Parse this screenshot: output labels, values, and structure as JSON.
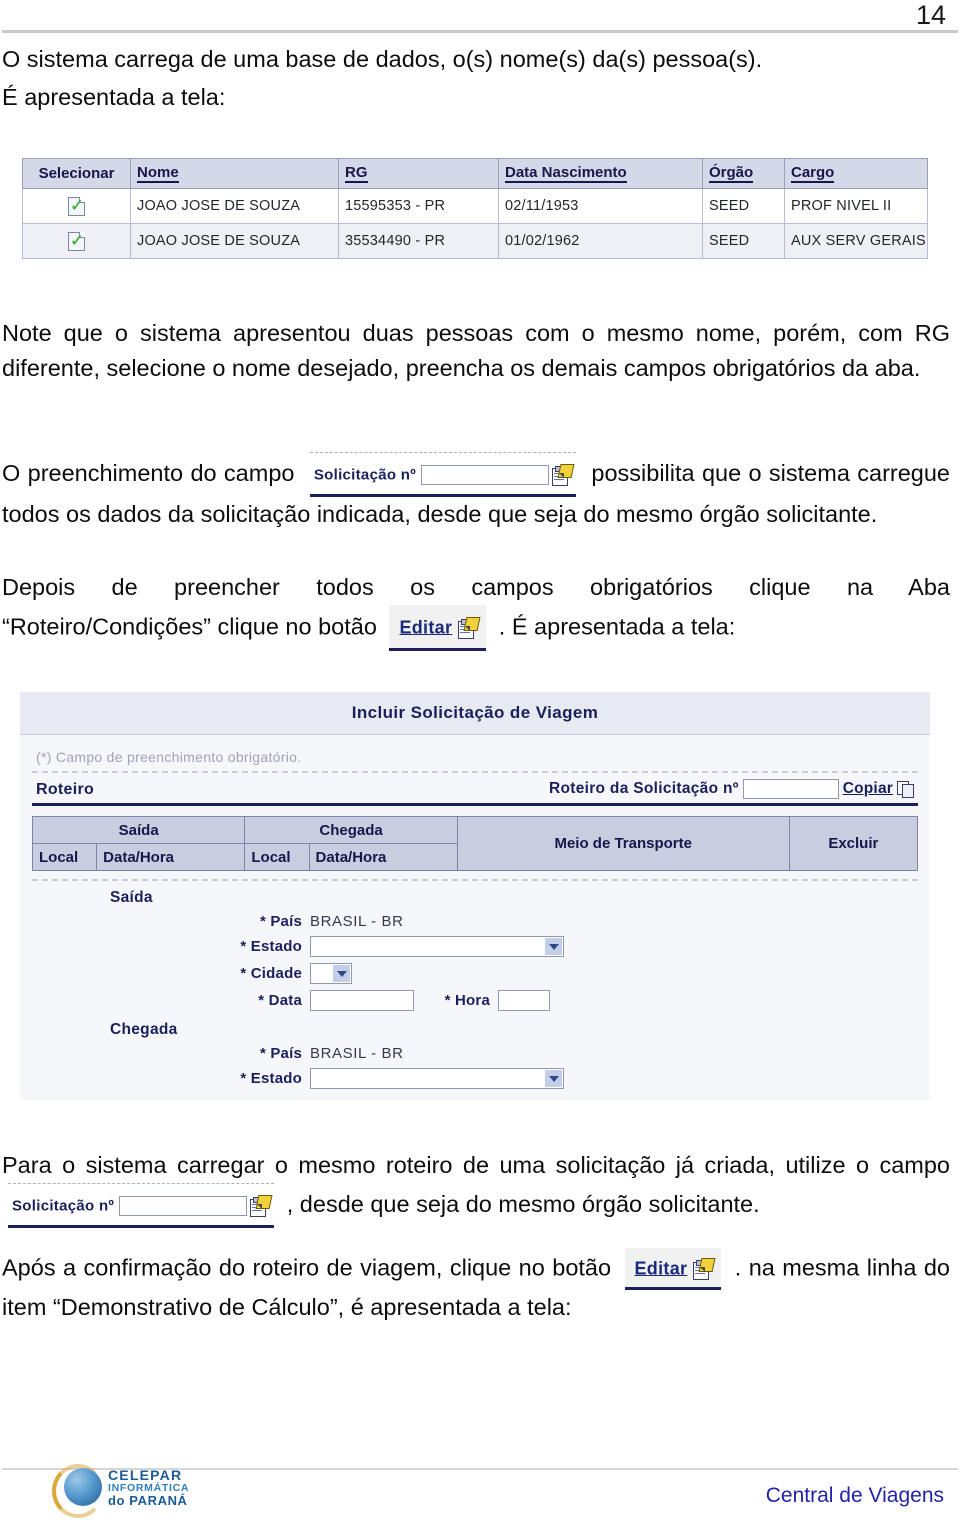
{
  "page": {
    "number": "14",
    "footer_right": "Central de Viagens"
  },
  "intro": {
    "line1": "O sistema carrega de uma base de dados, o(s) nome(s) da(s) pessoa(s).",
    "line2": "É apresentada a tela:"
  },
  "result_table": {
    "headers": [
      "Selecionar",
      "Nome",
      "RG",
      "Data Nascimento",
      "Órgão",
      "Cargo"
    ],
    "rows": [
      {
        "select_icon": "document-check-icon",
        "nome": "JOAO JOSE DE SOUZA",
        "rg": "15595353 - PR",
        "data_nascimento": "02/11/1953",
        "orgao": "SEED",
        "cargo": "PROF NIVEL II"
      },
      {
        "select_icon": "document-check-icon",
        "nome": "JOAO JOSE DE SOUZA",
        "rg": "35534490 - PR",
        "data_nascimento": "01/02/1962",
        "orgao": "SEED",
        "cargo": "AUX SERV GERAIS"
      }
    ]
  },
  "note_paragraph": "Note que o sistema apresentou duas pessoas com o mesmo nome, porém, com RG diferente, selecione o nome desejado, preencha os demais campos obrigatórios da aba.",
  "solicitacao_paragraph": {
    "before": "O preenchimento do campo",
    "widget_label": "Solicitação nº",
    "widget_value": "",
    "after": "possibilita que o sistema carregue todos os dados da solicitação indicada, desde que seja do mesmo órgão solicitante."
  },
  "editar_paragraph": {
    "line1": "Depois de preencher todos os campos obrigatórios clique na Aba",
    "line2_before": "“Roteiro/Condições” clique no botão",
    "button_label": "Editar",
    "line2_after": ". É apresentada a tela:"
  },
  "screenshot": {
    "title": "Incluir Solicitação de Viagem",
    "obligatory_note": "(*) Campo de preenchimento obrigatório.",
    "roteiro_label": "Roteiro",
    "roteiro_solicitacao_label": "Roteiro da Solicitação nº",
    "roteiro_solicitacao_value": "",
    "copiar_label": "Copiar",
    "route_headers": {
      "saida": "Saída",
      "chegada": "Chegada",
      "meio_transporte": "Meio de Transporte",
      "excluir": "Excluir",
      "local": "Local",
      "data_hora": "Data/Hora"
    },
    "saida": {
      "title": "Saída",
      "pais_label": "* País",
      "pais_value": "BRASIL - BR",
      "estado_label": "* Estado",
      "estado_value": "",
      "cidade_label": "* Cidade",
      "cidade_value": "",
      "data_label": "* Data",
      "data_value": "",
      "hora_label": "* Hora",
      "hora_value": ""
    },
    "chegada": {
      "title": "Chegada",
      "pais_label": "* País",
      "pais_value": "BRASIL - BR",
      "estado_label": "* Estado",
      "estado_value": ""
    }
  },
  "bottom": {
    "para1_before": "Para o sistema carregar o mesmo roteiro de uma solicitação já criada, utilize o campo",
    "para1_widget_label": "Solicitação nº",
    "para1_widget_value": "",
    "para1_after": ", desde que seja do mesmo órgão solicitante.",
    "para2_before": "Após a confirmação do roteiro de viagem, clique no botão",
    "para2_button_label": "Editar",
    "para2_after": ". na mesma linha do item “Demonstrativo de Cálculo”, é apresentada a tela:"
  },
  "logo": {
    "line1": "CELEPAR",
    "line2": "INFORMÁTICA",
    "line3": "do PARANÁ"
  },
  "colors": {
    "header_blue": "#1b1f5c",
    "table_header_bg": "#d4d8e8",
    "link_blue": "#2222aa",
    "check_green": "#3aa832",
    "logo_blue": "#1d5b96",
    "logo_gold": "#d9a93c"
  }
}
